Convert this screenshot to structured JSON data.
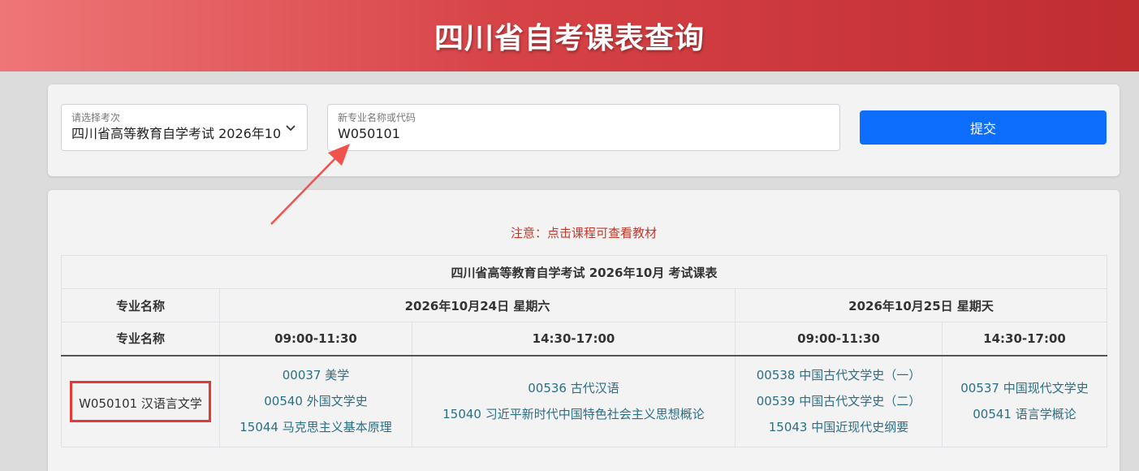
{
  "header": {
    "title": "四川省自考课表查询"
  },
  "form": {
    "exam_select": {
      "label": "请选择考次",
      "value": "四川省高等教育自学考试 2026年10"
    },
    "major_input": {
      "label": "新专业名称或代码",
      "value": "W050101"
    },
    "submit_label": "提交"
  },
  "notice": "注意：点击课程可查看教材",
  "table": {
    "title": "四川省高等教育自学考试 2026年10月 考试课表",
    "major_header": "专业名称",
    "dates": [
      "2026年10月24日 星期六",
      "2026年10月25日 星期天"
    ],
    "times": [
      "09:00-11:30",
      "14:30-17:00",
      "09:00-11:30",
      "14:30-17:00"
    ],
    "row": {
      "major": "W050101 汉语言文学",
      "slots": [
        [
          "00037 美学",
          "00540 外国文学史",
          "15044 马克思主义基本原理"
        ],
        [
          "00536 古代汉语",
          "15040 习近平新时代中国特色社会主义思想概论"
        ],
        [
          "00538 中国古代文学史（一）",
          "00539 中国古代文学史（二）",
          "15043 中国近现代史纲要"
        ],
        [
          "00537 中国现代文学史",
          "00541 语言学概论"
        ]
      ]
    }
  },
  "colors": {
    "accent": "#0d6efd",
    "notice": "#c0392b",
    "course_link": "#2a6f86",
    "highlight": "#e53935"
  }
}
